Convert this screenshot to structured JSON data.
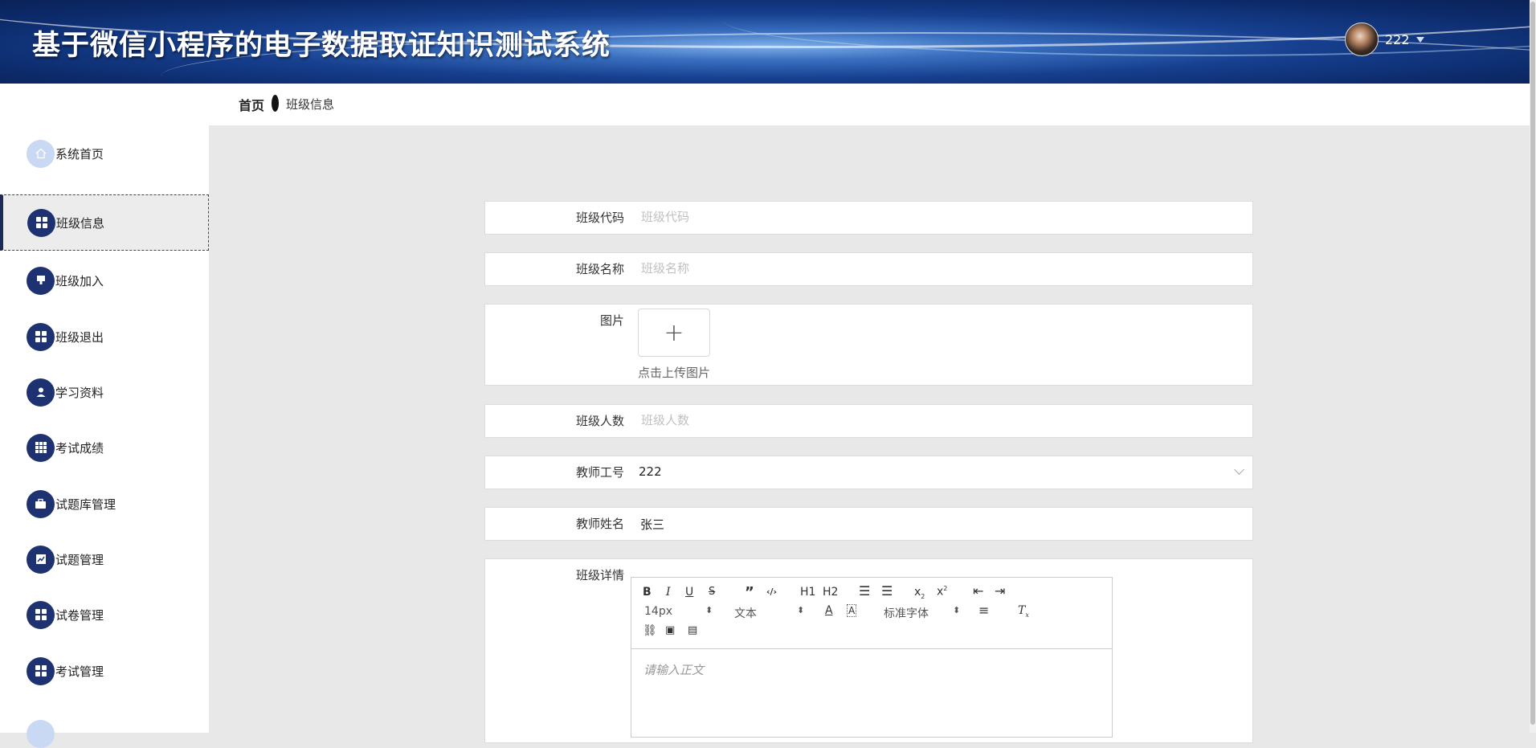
{
  "header": {
    "title": "基于微信小程序的电子数据取证知识测试系统",
    "username": "222"
  },
  "breadcrumb": {
    "home": "首页",
    "current": "班级信息"
  },
  "sidebar": {
    "items": [
      {
        "label": "系统首页",
        "icon": "home-icon"
      },
      {
        "label": "班级信息",
        "icon": "grid-icon"
      },
      {
        "label": "班级加入",
        "icon": "stamp-icon"
      },
      {
        "label": "班级退出",
        "icon": "grid-icon"
      },
      {
        "label": "学习资料",
        "icon": "user-icon"
      },
      {
        "label": "考试成绩",
        "icon": "table-icon"
      },
      {
        "label": "试题库管理",
        "icon": "briefcase-icon"
      },
      {
        "label": "试题管理",
        "icon": "chart-icon"
      },
      {
        "label": "试卷管理",
        "icon": "grid-icon"
      },
      {
        "label": "考试管理",
        "icon": "grid-icon"
      }
    ]
  },
  "form": {
    "class_code": {
      "label": "班级代码",
      "placeholder": "班级代码"
    },
    "class_name": {
      "label": "班级名称",
      "placeholder": "班级名称"
    },
    "image": {
      "label": "图片",
      "hint": "点击上传图片"
    },
    "class_size": {
      "label": "班级人数",
      "placeholder": "班级人数"
    },
    "teacher_id": {
      "label": "教师工号",
      "value": "222"
    },
    "teacher_name": {
      "label": "教师姓名",
      "value": "张三"
    },
    "class_detail": {
      "label": "班级详情"
    }
  },
  "editor": {
    "font_size": "14px",
    "block_format": "文本",
    "font_family": "标准字体",
    "h1": "H1",
    "h2": "H2",
    "placeholder": "请输入正文"
  }
}
